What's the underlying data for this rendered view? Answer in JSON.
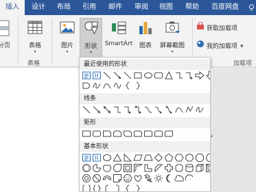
{
  "ribbon_tabs": [
    "插入",
    "设计",
    "布局",
    "引用",
    "邮件",
    "审阅",
    "视图",
    "帮助",
    "百度网盘"
  ],
  "ribbon": {
    "partial_label": "分页",
    "table_label": "表格",
    "table_group_label": "表格",
    "picture_label": "图片",
    "shapes_label": "形状",
    "smartart_label": "SmartArt",
    "chart_label": "图表",
    "screenshot_label": "屏幕截图",
    "caret": "▾",
    "get_addins_label": "获取加载项",
    "my_addins_label": "我的加载项",
    "addins_group_label": "加载项"
  },
  "shapes_menu": {
    "sections": [
      {
        "title": "最近使用的形状"
      },
      {
        "title": "线条"
      },
      {
        "title": "矩形"
      },
      {
        "title": "基本形状"
      }
    ]
  },
  "document": {
    "paragraph_mark": "↵"
  },
  "colors": {
    "accent": "#2b579a",
    "ribbon_bg": "#f3f3f3",
    "icon_blue": "#2b6cb0"
  }
}
